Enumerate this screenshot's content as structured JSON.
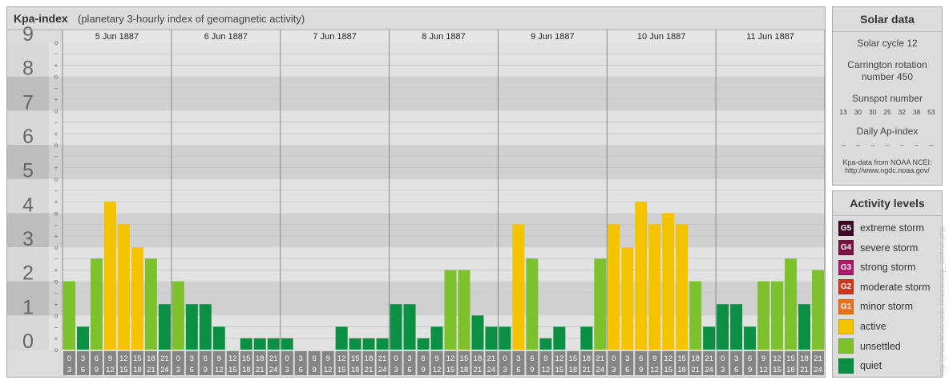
{
  "header": {
    "title": "Kpa-index",
    "subtitle": "(planetary 3-hourly index of geomagnetic activity)"
  },
  "chart_data": {
    "type": "bar",
    "title": "Kpa-index",
    "subtitle": "(planetary 3-hourly index of geomagnetic activity)",
    "y_ticks": [
      "0",
      "1",
      "2",
      "3",
      "4",
      "5",
      "6",
      "7",
      "8",
      "9"
    ],
    "ylim": [
      0,
      9
    ],
    "minor_tick_labels": [
      "o",
      "+",
      "–"
    ],
    "days": [
      "5 Jun 1887",
      "6 Jun 1887",
      "7 Jun 1887",
      "8 Jun 1887",
      "9 Jun 1887",
      "10 Jun 1887",
      "11 Jun 1887"
    ],
    "interval_start": [
      "0",
      "3",
      "6",
      "9",
      "12",
      "15",
      "18",
      "21"
    ],
    "interval_end": [
      "3",
      "6",
      "9",
      "12",
      "15",
      "18",
      "21",
      "24"
    ],
    "values": [
      [
        2.0,
        0.67,
        2.67,
        4.33,
        3.67,
        3.0,
        2.67,
        1.33
      ],
      [
        2.0,
        1.33,
        1.33,
        0.67,
        0.0,
        0.33,
        0.33,
        0.33
      ],
      [
        0.33,
        0.0,
        0.0,
        0.0,
        0.67,
        0.33,
        0.33,
        0.33
      ],
      [
        1.33,
        1.33,
        0.33,
        0.67,
        2.33,
        2.33,
        1.0,
        0.67
      ],
      [
        0.67,
        3.67,
        2.67,
        0.33,
        0.67,
        0.0,
        0.67,
        2.67
      ],
      [
        3.67,
        3.0,
        4.33,
        3.67,
        4.0,
        3.67,
        2.0,
        0.67
      ],
      [
        1.33,
        1.33,
        0.67,
        2.0,
        2.0,
        2.67,
        1.33,
        2.33
      ]
    ],
    "colors": {
      "quiet": "#0a8f43",
      "unsettled": "#7dc22c",
      "active": "#f5c400",
      "minor_storm": "#e8731c",
      "moderate_storm": "#d0341c",
      "strong_storm": "#b0196a",
      "severe_storm": "#7a1143",
      "extreme_storm": "#3c0a24"
    }
  },
  "solar": {
    "heading": "Solar data",
    "cycle": "Solar cycle 12",
    "carrington_line1": "Carrington rotation",
    "carrington_line2": "number 450",
    "sunspot_label": "Sunspot number",
    "sunspot_values": [
      "13",
      "30",
      "30",
      "25",
      "32",
      "38",
      "53"
    ],
    "ap_label": "Daily Ap-index",
    "ap_values": [
      "–",
      "–",
      "–",
      "–",
      "–",
      "–",
      "–"
    ],
    "source_line1": "Kpa-data from NOAA NCEI:",
    "source_line2": "http://www.ngdc.noaa.gov/"
  },
  "levels": {
    "heading": "Activity levels",
    "items": [
      {
        "badge": "G5",
        "label": "extreme storm",
        "color": "#3c0a24"
      },
      {
        "badge": "G4",
        "label": "severe storm",
        "color": "#7a1143"
      },
      {
        "badge": "G3",
        "label": "strong storm",
        "color": "#b0196a"
      },
      {
        "badge": "G2",
        "label": "moderate storm",
        "color": "#d0341c"
      },
      {
        "badge": "G1",
        "label": "minor storm",
        "color": "#e8731c"
      },
      {
        "badge": "",
        "label": "active",
        "color": "#f5c400"
      },
      {
        "badge": "",
        "label": "unsettled",
        "color": "#7dc22c"
      },
      {
        "badge": "",
        "label": "quiet",
        "color": "#0a8f43"
      }
    ]
  },
  "watermark": "http://www.fleuseurde.fr/aurora/kp_archive.php"
}
